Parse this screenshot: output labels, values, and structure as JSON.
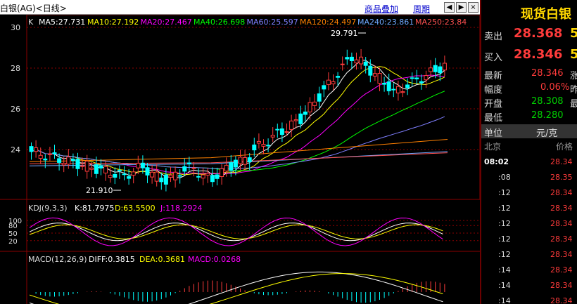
{
  "topbar": {
    "title": "白银(AG)<日线>",
    "overlay_label": "商品叠加",
    "period_label": "周期",
    "prev_btn": "◀",
    "next_btn": "▶"
  },
  "main_chart": {
    "prefix": "K",
    "ma": [
      {
        "label": "MA5:27.731",
        "color": "#ffffff"
      },
      {
        "label": "MA10:27.192",
        "color": "#ffff00"
      },
      {
        "label": "MA20:27.467",
        "color": "#ff00ff"
      },
      {
        "label": "MA40:26.698",
        "color": "#00ff00"
      },
      {
        "label": "MA60:25.597",
        "color": "#7f7fff"
      },
      {
        "label": "MA120:24.497",
        "color": "#ff8000"
      },
      {
        "label": "MA240:23.861",
        "color": "#6fa8ff"
      },
      {
        "label": "MA250:23.84",
        "color": "#ff5050"
      }
    ],
    "y_ticks": [
      "30",
      "28",
      "26",
      "24"
    ],
    "high_label": "29.791",
    "low_label": "21.910"
  },
  "kdj": {
    "label": "KDJ(9,3,3)",
    "k": "K:81.7975",
    "d": "D:63.5500",
    "j": "J:118.2924",
    "y_ticks": [
      "100",
      "80",
      "50",
      "20"
    ]
  },
  "macd": {
    "label": "MACD(12,26,9)",
    "diff": "DIFF:0.3815",
    "dea": "DEA:0.3681",
    "macd": "MACD:0.0268"
  },
  "side": {
    "title": "现货白银",
    "sell_label": "卖出",
    "sell_value": "28.368",
    "sell_extra": "5",
    "buy_label": "买入",
    "buy_value": "28.346",
    "buy_extra": "5",
    "latest_label": "最新",
    "latest_value": "28.346",
    "latest_extra": "涨",
    "range_label": "幅度",
    "range_value": "0.06%",
    "range_extra": "昨",
    "open_label": "开盘",
    "open_value": "28.308",
    "open_extra": "最",
    "low_label": "最低",
    "low_value": "28.280",
    "unit_label": "单位",
    "unit_value": "元/克",
    "tz_label": "北京",
    "price_label": "价格",
    "ticks": [
      {
        "time": "08:02",
        "price": "28.34"
      },
      {
        "time": ":08",
        "price": "28.35"
      },
      {
        "time": ":12",
        "price": "28.34"
      },
      {
        "time": ":12",
        "price": "28.34"
      },
      {
        "time": ":12",
        "price": "28.34"
      },
      {
        "time": ":12",
        "price": "28.34"
      },
      {
        "time": ":12",
        "price": "28.34"
      },
      {
        "time": ":14",
        "price": "28.34"
      },
      {
        "time": ":14",
        "price": "28.34"
      },
      {
        "time": ":14",
        "price": "28.34"
      }
    ]
  }
}
